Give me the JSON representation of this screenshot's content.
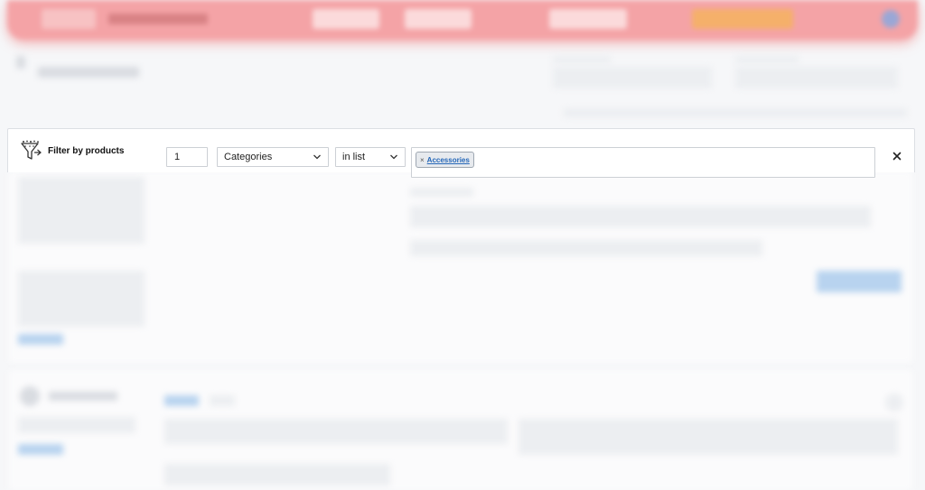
{
  "filter": {
    "title": "Filter by products",
    "count_value": "1",
    "field_select": "Categories",
    "operator_select": "in list",
    "tags": [
      {
        "remove_glyph": "×",
        "label": "Accessories"
      }
    ],
    "icons": {
      "filter": "filter-funnel-icon",
      "close": "close-icon",
      "chevron": "chevron-down-icon"
    }
  },
  "colors": {
    "header_bg": "#f4a3a6",
    "tag_link": "#2567b8",
    "tag_bg": "#e7eaee"
  }
}
